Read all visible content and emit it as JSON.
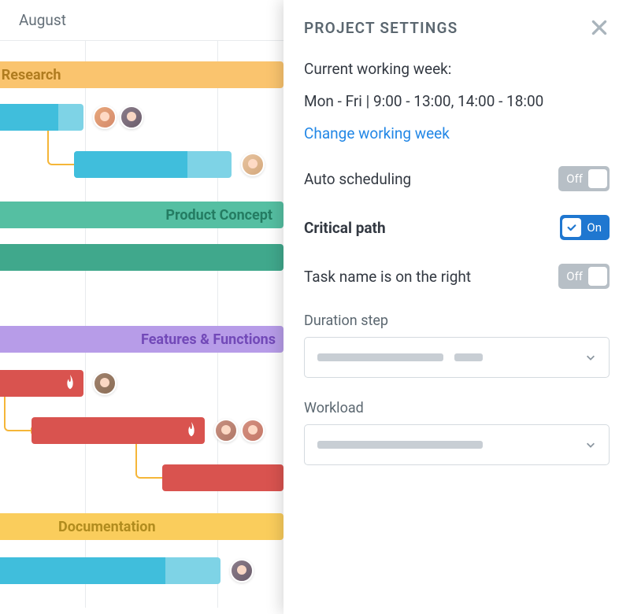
{
  "gantt": {
    "month": "August",
    "groups": [
      {
        "id": "market-research",
        "label": "ket Research",
        "colorClass": "g-orange"
      },
      {
        "id": "product-concept",
        "label": "Product Concept",
        "colorClass": "g-teal"
      },
      {
        "id": "features",
        "label": "Features & Functions",
        "colorClass": "g-purple"
      },
      {
        "id": "docs",
        "label": "Documentation",
        "colorClass": "g-gold"
      }
    ]
  },
  "panel": {
    "title": "PROJECT SETTINGS",
    "workingWeekLabel": "Current working week:",
    "workingWeekValue": "Mon - Fri | 9:00 - 13:00, 14:00 - 18:00",
    "changeLink": "Change working week",
    "settings": {
      "autoScheduling": {
        "label": "Auto scheduling",
        "state": "Off",
        "on": false
      },
      "criticalPath": {
        "label": "Critical path",
        "state": "On",
        "on": true
      },
      "taskNameRight": {
        "label": "Task name is on the right",
        "state": "Off",
        "on": false
      }
    },
    "fields": {
      "durationStep": {
        "label": "Duration step"
      },
      "workload": {
        "label": "Workload"
      }
    }
  }
}
